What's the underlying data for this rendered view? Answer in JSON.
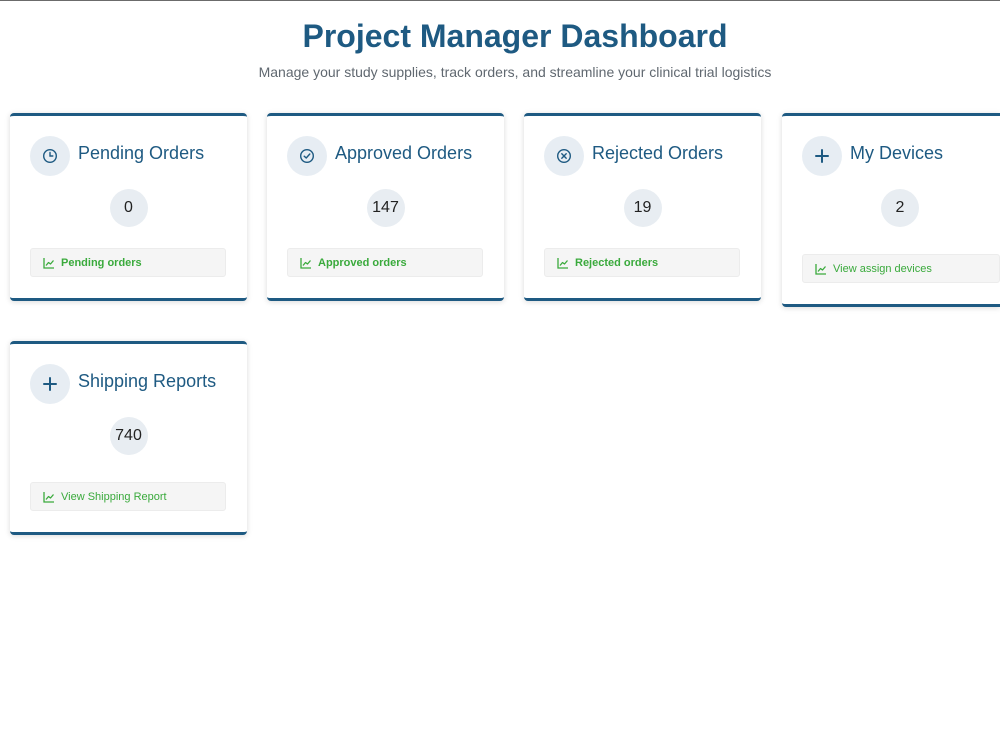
{
  "header": {
    "title": "Project Manager Dashboard",
    "subtitle": "Manage your study supplies, track orders, and streamline your clinical trial logistics"
  },
  "colors": {
    "primary": "#1e5a82",
    "link_green": "#3aaa3c",
    "bubble_bg": "#e8edf2"
  },
  "cards": [
    {
      "title": "Pending Orders",
      "icon": "clock-icon",
      "count": "0",
      "link": "Pending orders"
    },
    {
      "title": "Approved Orders",
      "icon": "check-circle-icon",
      "count": "147",
      "link": "Approved orders"
    },
    {
      "title": "Rejected Orders",
      "icon": "x-circle-icon",
      "count": "19",
      "link": "Rejected orders"
    },
    {
      "title": "My Devices",
      "icon": "plus-icon",
      "count": "2",
      "link": "View assign devices"
    },
    {
      "title": "Shipping Reports",
      "icon": "plus-icon",
      "count": "740",
      "link": "View Shipping Report"
    }
  ],
  "link_icon": "chart-line-icon"
}
